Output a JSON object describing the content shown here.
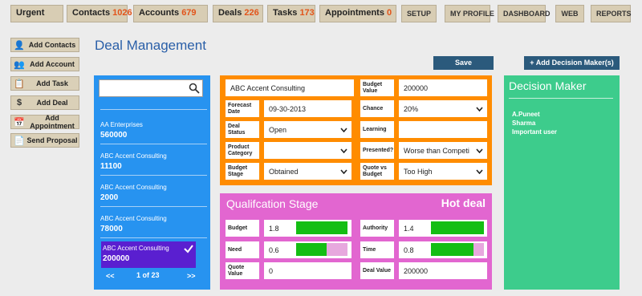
{
  "top_tabs": [
    {
      "label": "Urgent",
      "count": ""
    },
    {
      "label": "Contacts",
      "count": "1026"
    },
    {
      "label": "Accounts",
      "count": "679"
    },
    {
      "label": "Deals",
      "count": "226"
    },
    {
      "label": "Tasks",
      "count": "173"
    },
    {
      "label": "Appointments",
      "count": "0"
    }
  ],
  "right_tabs": [
    "SETUP",
    "MY PROFILE",
    "DASHBOARD",
    "WEB",
    "REPORTS"
  ],
  "actions": [
    "Add Contacts",
    "Add Account",
    "Add Task",
    "Add Deal",
    "Add Appointment",
    "Send Proposal"
  ],
  "page_title": "Deal Management",
  "save_label": "Save",
  "add_decision_label": "+ Add Decision Maker(s)",
  "search": {
    "value": ""
  },
  "list": [
    {
      "name": "AA Enterprises",
      "value": "560000"
    },
    {
      "name": "ABC Accent Consulting",
      "value": "11100"
    },
    {
      "name": "ABC Accent Consulting",
      "value": "2000"
    },
    {
      "name": "ABC Accent Consulting",
      "value": "78000"
    },
    {
      "name": "ABC Accent Consulting",
      "value": "200000"
    }
  ],
  "pager": {
    "prev": "<<",
    "text": "1 of 23",
    "next": ">>"
  },
  "deal": {
    "name": "ABC Accent Consulting",
    "budget_value_label": "Budget Value",
    "budget_value": "200000",
    "forecast_date_label": "Forecast Date",
    "forecast_date": "09-30-2013",
    "chance_label": "Chance",
    "chance": "20%",
    "deal_status_label": "Deal Status",
    "deal_status": "Open",
    "learning_label": "Learning",
    "learning": "",
    "product_category_label": "Product Category",
    "product_category": "",
    "presented_label": "Presented?",
    "presented": "Worse than Competi",
    "budget_stage_label": "Budget Stage",
    "budget_stage": "Obtained",
    "quote_vs_budget_label": "Quote vs Budget",
    "quote_vs_budget": "Too High"
  },
  "qualification": {
    "title": "Qualifcation Stage",
    "hot": "Hot deal",
    "budget_label": "Budget",
    "budget": "1.8",
    "budget_fill": 1.0,
    "authority_label": "Authority",
    "authority": "1.4",
    "authority_fill": 1.0,
    "need_label": "Need",
    "need": "0.6",
    "need_fill": 0.6,
    "time_label": "Time",
    "time": "0.8",
    "time_fill": 0.8,
    "quote_value_label": "Quote Value",
    "quote_value": "0",
    "deal_value_label": "Deal Value",
    "deal_value": "200000"
  },
  "decision": {
    "title": "Decision Maker",
    "name_line1": "A.Puneet",
    "name_line2": "Sharma",
    "note": "Important user"
  }
}
